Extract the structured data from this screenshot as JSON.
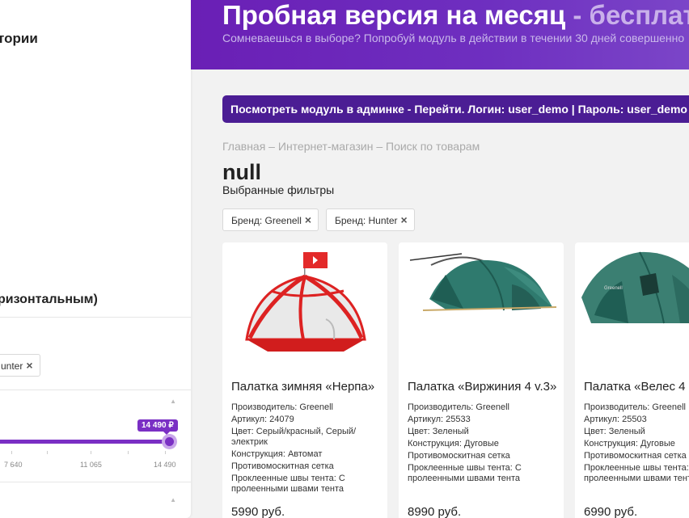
{
  "sidebar": {
    "categories_title_fragment": "тории",
    "layout_title_fragment": "ризонтальным)",
    "selected_chip": "unter",
    "price": {
      "current_badge": "14 490 ₽",
      "ticks": [
        "7 640",
        "11 065",
        "14 490"
      ]
    }
  },
  "banner": {
    "title_main": "Пробная версия на месяц",
    "title_muted": " - бесплат",
    "subtitle": "Сомневаешься в выборе? Попробуй модуль в действии в течении 30 дней совершенно"
  },
  "admin_bar": {
    "text": "Посмотреть модуль в админке - Перейти. Логин: user_demo | Пароль: user_demo"
  },
  "breadcrumb": {
    "items": [
      "Главная",
      "Интернет-магазин",
      "Поиск по товарам"
    ],
    "separator": " – "
  },
  "page_title": "null",
  "filters": {
    "label": "Выбранные фильтры",
    "chips": [
      "Бренд: Greenell",
      "Бренд: Hunter"
    ],
    "remove_symbol": "×"
  },
  "products": [
    {
      "name": "Палатка зимняя «Нерпа»",
      "manufacturer": "Производитель: Greenell",
      "sku": "Артикул: 24079",
      "color": "Цвет: Серый/красный, Серый/электрик",
      "construction": "Конструкция: Автомат",
      "feature": "Противомоскитная сетка",
      "seams": "Проклеенные швы тента: С пролеенными швами тента",
      "price": "5990 руб."
    },
    {
      "name": "Палатка «Виржиния 4 v.3»",
      "manufacturer": "Производитель: Greenell",
      "sku": "Артикул: 25533",
      "color": "Цвет: Зеленый",
      "construction": "Конструкция: Дуговые",
      "feature": "Противомоскитная сетка",
      "seams": "Проклеенные швы тента: С пролеенными швами тента",
      "price": "8990 руб."
    },
    {
      "name": "Палатка «Велес 4",
      "manufacturer": "Производитель: Greenell",
      "sku": "Артикул: 25503",
      "color": "Цвет: Зеленый",
      "construction": "Конструкция: Дуговые",
      "feature": "Противомоскитная сетка",
      "seams": "Проклеенные швы тента: С пролеенными швами тента",
      "price": "6990 руб."
    }
  ],
  "colors": {
    "accent": "#7a2fc4",
    "banner": "#6a1fb5",
    "admin_bar": "#4b1d94"
  }
}
